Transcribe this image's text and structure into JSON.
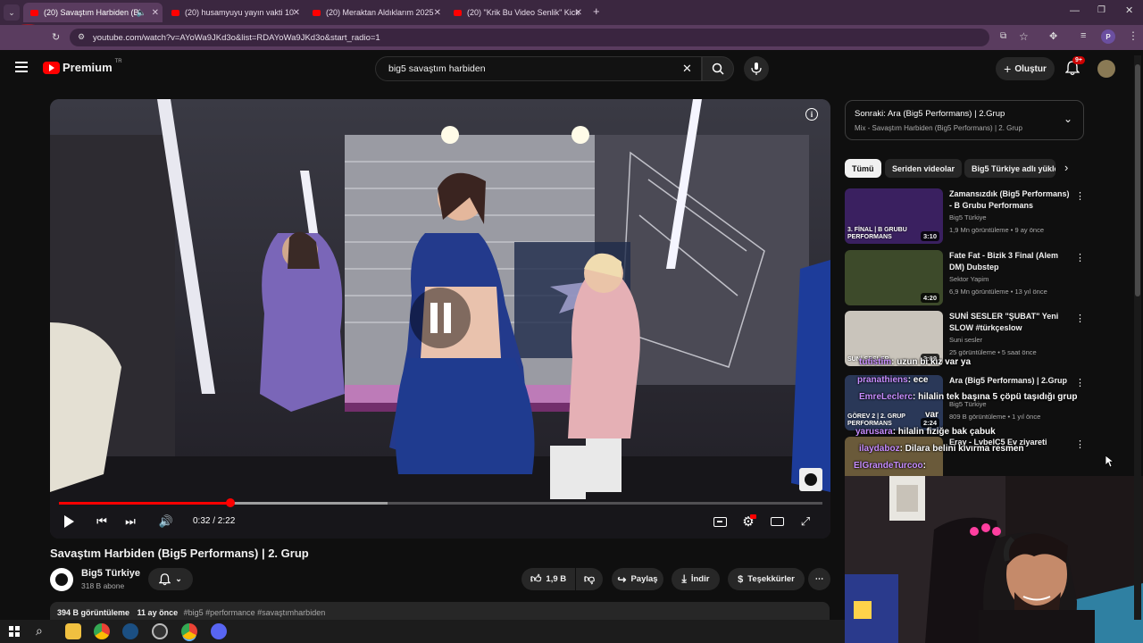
{
  "browser": {
    "tabs": [
      {
        "label": "(20) Savaştım Harbiden (Bi",
        "active": true
      },
      {
        "label": "(20) husamyuyu yayın vakti 10"
      },
      {
        "label": "(20) Meraktan Aldıklarım 2025"
      },
      {
        "label": "(20) \"Krik Bu Video Senlik\" Kick"
      }
    ],
    "url": "youtube.com/watch?v=AYoWa9JKd3o&list=RDAYoWa9JKd3o&start_radio=1",
    "profile_initial": "P"
  },
  "header": {
    "logo_text": "Premium",
    "logo_region": "TR",
    "search_value": "big5 savaştım harbiden",
    "create_label": "Oluştur",
    "notif_count": "9+"
  },
  "player": {
    "time": "0:32 / 2:22",
    "progress_fraction": 0.225,
    "buffer_fraction": 0.43
  },
  "video": {
    "title": "Savaştım Harbiden (Big5 Performans) | 2. Grup",
    "channel": "Big5 Türkiye",
    "subs": "318 B abone",
    "likes": "1,9 B",
    "share_label": "Paylaş",
    "download_label": "İndir",
    "thanks_label": "Teşekkürler",
    "views": "394 B görüntüleme",
    "age": "11 ay önce",
    "tags": "#big5 #performance #savaştımharbiden"
  },
  "playlist": {
    "next_label": "Sonraki: Ara (Big5 Performans) | 2.Grup",
    "mix_label": "Mix - Savaştım Harbiden (Big5 Performans) | 2. Grup"
  },
  "chips": [
    "Tümü",
    "Seriden videolar",
    "Big5 Türkiye adlı yükleyen"
  ],
  "recommendations": [
    {
      "title": "Zamansızdık (Big5 Performans) - B Grubu Performans",
      "channel": "Big5 Türkiye",
      "meta": "1,9 Mn görüntüleme • 9 ay önce",
      "duration": "3:10",
      "thumb_caption": "3. FİNAL | B GRUBU PERFORMANS",
      "thumb_color": "#3a2060"
    },
    {
      "title": "Fate Fat - Bizik 3 Final (Alem DM) Dubstep",
      "channel": "Sektor Yapim",
      "meta": "6,9 Mn görüntüleme • 13 yıl önce",
      "duration": "4:20",
      "thumb_color": "#3d4a2a"
    },
    {
      "title": "SUNİ SESLER \"ŞUBAT\" Yeni SLOW #türkçeslow",
      "channel": "Suni sesler",
      "meta": "25 görüntüleme • 5 saat önce",
      "duration": "3:09",
      "thumb_caption": "SUNİ SESLER",
      "thumb_color": "#c9c4bb"
    },
    {
      "title": "Ara (Big5 Performans) | 2.Grup",
      "channel": "Big5 Türkiye",
      "meta": "809 B görüntüleme • 1 yıl önce",
      "duration": "2:24",
      "thumb_caption": "GÖREV 2 | 2. GRUP PERFORMANS",
      "thumb_color": "#2a3858"
    },
    {
      "title": "Eray - LvbelC5 Ev ziyareti",
      "channel": "",
      "meta": "",
      "duration": "",
      "thumb_color": "#6a5a3a"
    }
  ],
  "chat_overlay": [
    {
      "user": "tutistim",
      "text": ": uzun bi kız var ya"
    },
    {
      "user": "pranathiens",
      "text": ": ece"
    },
    {
      "user": "EmreLeclerc",
      "text": ": hilalin tek başına 5 çöpü taşıdığı grup"
    },
    {
      "user": "",
      "text": "var"
    },
    {
      "user": "yarusara",
      "text": ": hilalin fiziğe bak çabuk"
    },
    {
      "user": "ilaydaboz",
      "text": ": Dilara belini kıvırma resmen"
    },
    {
      "user": "ElGrandeTurcoo",
      "text": ":"
    }
  ],
  "colors": {
    "accent_red": "#ff0000",
    "browser_frame": "#5a3c5f",
    "chat_username": "#c78dff"
  }
}
